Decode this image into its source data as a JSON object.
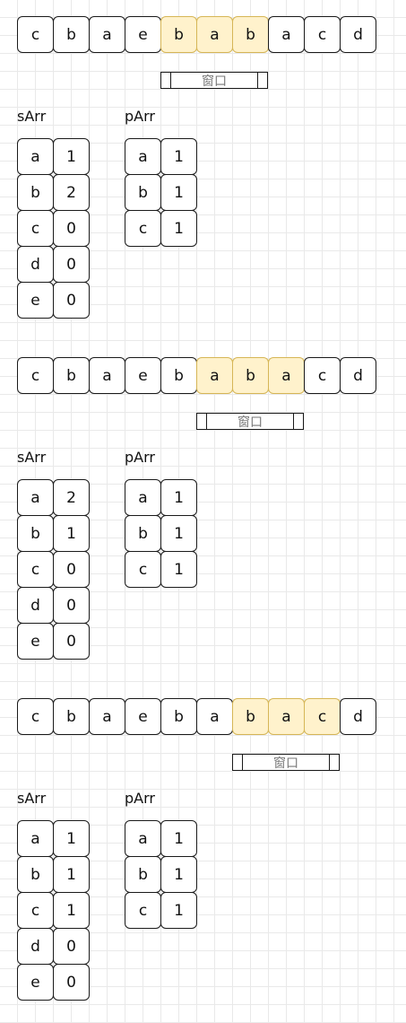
{
  "window_label": "窗口",
  "sections": [
    {
      "string": [
        "c",
        "b",
        "a",
        "e",
        "b",
        "a",
        "b",
        "a",
        "c",
        "d"
      ],
      "highlight_start": 4,
      "highlight_len": 3,
      "sArr_label": "sArr",
      "pArr_label": "pArr",
      "sArr": [
        [
          "a",
          "1"
        ],
        [
          "b",
          "2"
        ],
        [
          "c",
          "0"
        ],
        [
          "d",
          "0"
        ],
        [
          "e",
          "0"
        ]
      ],
      "pArr": [
        [
          "a",
          "1"
        ],
        [
          "b",
          "1"
        ],
        [
          "c",
          "1"
        ]
      ]
    },
    {
      "string": [
        "c",
        "b",
        "a",
        "e",
        "b",
        "a",
        "b",
        "a",
        "c",
        "d"
      ],
      "highlight_start": 5,
      "highlight_len": 3,
      "sArr_label": "sArr",
      "pArr_label": "pArr",
      "sArr": [
        [
          "a",
          "2"
        ],
        [
          "b",
          "1"
        ],
        [
          "c",
          "0"
        ],
        [
          "d",
          "0"
        ],
        [
          "e",
          "0"
        ]
      ],
      "pArr": [
        [
          "a",
          "1"
        ],
        [
          "b",
          "1"
        ],
        [
          "c",
          "1"
        ]
      ]
    },
    {
      "string": [
        "c",
        "b",
        "a",
        "e",
        "b",
        "a",
        "b",
        "a",
        "c",
        "d"
      ],
      "highlight_start": 6,
      "highlight_len": 3,
      "sArr_label": "sArr",
      "pArr_label": "pArr",
      "sArr": [
        [
          "a",
          "1"
        ],
        [
          "b",
          "1"
        ],
        [
          "c",
          "1"
        ],
        [
          "d",
          "0"
        ],
        [
          "e",
          "0"
        ]
      ],
      "pArr": [
        [
          "a",
          "1"
        ],
        [
          "b",
          "1"
        ],
        [
          "c",
          "1"
        ]
      ]
    }
  ]
}
